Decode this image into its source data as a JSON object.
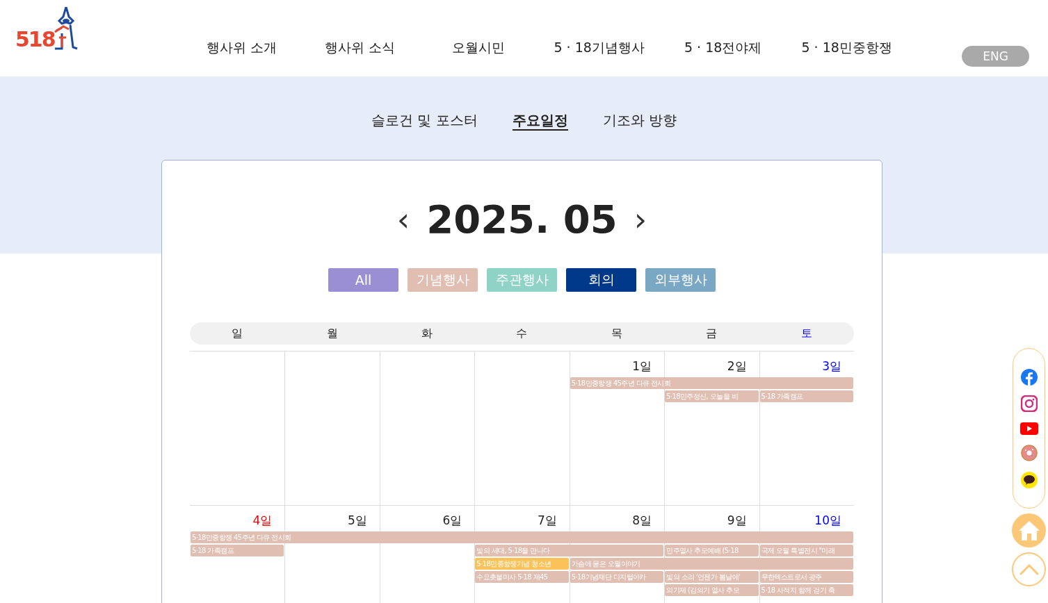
{
  "logo": {
    "text": "518"
  },
  "nav": [
    "행사위 소개",
    "행사위 소식",
    "오월시민",
    "5 · 18기념행사",
    "5 · 18전야제",
    "5 · 18민중항쟁"
  ],
  "lang_button": "ENG",
  "subtabs": [
    {
      "label": "슬로건 및 포스터",
      "selected": false
    },
    {
      "label": "주요일정",
      "selected": true
    },
    {
      "label": "기조와 방향",
      "selected": false
    }
  ],
  "month": {
    "title": "2025. 05",
    "prev": "‹",
    "next": "›"
  },
  "filters": [
    {
      "label": "All",
      "color": "#9b8fd3"
    },
    {
      "label": "기념행사",
      "color": "#e0bfb2"
    },
    {
      "label": "주관행사",
      "color": "#8fd3c6"
    },
    {
      "label": "회의",
      "color": "#00388a"
    },
    {
      "label": "외부행사",
      "color": "#7aa8c4"
    }
  ],
  "weekdays": [
    {
      "label": "일",
      "kind": "weekday"
    },
    {
      "label": "월",
      "kind": "weekday"
    },
    {
      "label": "화",
      "kind": "weekday"
    },
    {
      "label": "수",
      "kind": "weekday"
    },
    {
      "label": "목",
      "kind": "weekday"
    },
    {
      "label": "금",
      "kind": "weekday"
    },
    {
      "label": "토",
      "kind": "saturday"
    }
  ],
  "weeks": [
    {
      "days": [
        {
          "kind": "empty"
        },
        {
          "kind": "empty"
        },
        {
          "kind": "empty"
        },
        {
          "kind": "empty"
        },
        {
          "label": "1일",
          "kind": "weekday"
        },
        {
          "label": "2일",
          "kind": "weekday"
        },
        {
          "label": "3일",
          "kind": "saturday"
        }
      ],
      "lanes": [
        [
          {
            "kind": "empty"
          },
          {
            "kind": "empty"
          },
          {
            "kind": "empty"
          },
          {
            "kind": "empty"
          },
          {
            "kind": "event",
            "title": "5·18민중항쟁 45주년 다큐 전시회",
            "color": "#e0bfb2"
          },
          {
            "kind": "continued"
          },
          {
            "kind": "continued"
          }
        ],
        [
          {
            "kind": "empty"
          },
          {
            "kind": "empty"
          },
          {
            "kind": "empty"
          },
          {
            "kind": "empty"
          },
          {
            "kind": "empty"
          },
          {
            "kind": "event",
            "title": "5·18민주정신, 오늘을 비",
            "color": "#e0bfb2"
          },
          {
            "kind": "event",
            "title": "5·18 가족캠프",
            "color": "#e0bfb2"
          }
        ]
      ]
    },
    {
      "days": [
        {
          "label": "4일",
          "kind": "sunday"
        },
        {
          "label": "5일",
          "kind": "weekday"
        },
        {
          "label": "6일",
          "kind": "weekday"
        },
        {
          "label": "7일",
          "kind": "weekday"
        },
        {
          "label": "8일",
          "kind": "weekday"
        },
        {
          "label": "9일",
          "kind": "weekday"
        },
        {
          "label": "10일",
          "kind": "saturday"
        }
      ],
      "lanes": [
        [
          {
            "kind": "event",
            "title": "5·18민중항쟁 45주년 다큐 전시회",
            "color": "#e0bfb2"
          },
          {
            "kind": "continued"
          },
          {
            "kind": "continued"
          },
          {
            "kind": "continued"
          },
          {
            "kind": "continued"
          },
          {
            "kind": "continued"
          },
          {
            "kind": "continued"
          }
        ],
        [
          {
            "kind": "event",
            "title": "5·18 가족캠프",
            "color": "#e0bfb2"
          },
          {
            "kind": "empty"
          },
          {
            "kind": "empty"
          },
          {
            "kind": "event",
            "title": "빛의 세대, 5·18을 만나다",
            "color": "#e0bfb2"
          },
          {
            "kind": "continued"
          },
          {
            "kind": "event",
            "title": "민주열사 추모예배 (5·18",
            "color": "#e0bfb2"
          },
          {
            "kind": "event",
            "title": "국제 오월 특별전시 \"미래",
            "color": "#e0bfb2"
          }
        ],
        [
          {
            "kind": "empty"
          },
          {
            "kind": "empty"
          },
          {
            "kind": "empty"
          },
          {
            "kind": "event",
            "title": "5·18민중항쟁기념 청소년",
            "color": "#fcc25a"
          },
          {
            "kind": "event",
            "title": "가슴에 묻은 오월이야기",
            "color": "#e0bfb2"
          },
          {
            "kind": "continued"
          },
          {
            "kind": "continued"
          }
        ],
        [
          {
            "kind": "empty"
          },
          {
            "kind": "empty"
          },
          {
            "kind": "empty"
          },
          {
            "kind": "event",
            "title": "수요촛불미사 5·18 제45",
            "color": "#e0bfb2"
          },
          {
            "kind": "event",
            "title": "5·18기념재단 디지털아카",
            "color": "#e0bfb2"
          },
          {
            "kind": "event",
            "title": "빛의 소리 '언젠가 봄날에'",
            "color": "#e0bfb2"
          },
          {
            "kind": "event",
            "title": "무한텍스트로서 광주",
            "color": "#e0bfb2"
          }
        ],
        [
          {
            "kind": "empty"
          },
          {
            "kind": "empty"
          },
          {
            "kind": "empty"
          },
          {
            "kind": "empty"
          },
          {
            "kind": "empty"
          },
          {
            "kind": "event",
            "title": "의기제 (김의기 열사 추모",
            "color": "#e0bfb2"
          },
          {
            "kind": "event",
            "title": "5·18 사적지 함께 걷기 축",
            "color": "#e0bfb2"
          }
        ]
      ]
    }
  ]
}
